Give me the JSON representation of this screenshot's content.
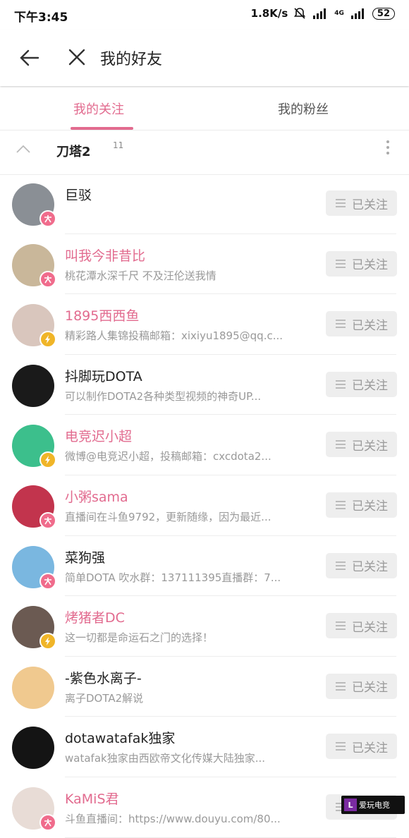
{
  "status": {
    "time": "下午3:45",
    "speed": "1.8K/s",
    "network": "4G",
    "battery": "52"
  },
  "header": {
    "title": "我的好友"
  },
  "tabs": [
    {
      "label": "我的关注"
    },
    {
      "label": "我的粉丝"
    }
  ],
  "group": {
    "name": "刀塔2",
    "count": "11"
  },
  "follow_label": "已关注",
  "users": [
    {
      "name": "巨驳",
      "desc": "",
      "name_color": "dark",
      "badge": "da",
      "avatar_color": "#8a8f95"
    },
    {
      "name": "叫我今非昔比",
      "desc": "桃花潭水深千尺 不及汪伦送我情",
      "name_color": "pink",
      "badge": "da",
      "avatar_color": "#c9b79a"
    },
    {
      "name": "1895西西鱼",
      "desc": "精彩路人集锦投稿邮箱：xixiyu1895@qq.c...",
      "name_color": "pink",
      "badge": "v",
      "avatar_color": "#d9c6bd"
    },
    {
      "name": "抖脚玩DOTA",
      "desc": "可以制作DOTA2各种类型视频的神奇UP...",
      "name_color": "dark",
      "badge": "",
      "avatar_color": "#1a1a1a"
    },
    {
      "name": "电竞迟小超",
      "desc": "微博@电竞迟小超，投稿邮箱：cxcdota2...",
      "name_color": "pink",
      "badge": "v",
      "avatar_color": "#3cbf8c"
    },
    {
      "name": "小粥sama",
      "desc": "直播间在斗鱼9792，更新随缘，因为最近...",
      "name_color": "pink",
      "badge": "da",
      "avatar_color": "#c2344d"
    },
    {
      "name": "菜狗强",
      "desc": "简单DOTA 吹水群：137111395直播群：7...",
      "name_color": "dark",
      "badge": "da",
      "avatar_color": "#7ab7e0"
    },
    {
      "name": "烤猪者DC",
      "desc": "这一切都是命运石之门的选择！",
      "name_color": "pink",
      "badge": "v",
      "avatar_color": "#6b5a52"
    },
    {
      "name": "-紫色水离子-",
      "desc": "离子DOTA2解说",
      "name_color": "dark",
      "badge": "",
      "avatar_color": "#f0c98f"
    },
    {
      "name": "dotawatafak独家",
      "desc": "watafak独家由西欧帝文化传媒大陆独家...",
      "name_color": "dark",
      "badge": "",
      "avatar_color": "#141414"
    },
    {
      "name": "KaMiS君",
      "desc": "斗鱼直播间：https://www.douyu.com/80...",
      "name_color": "pink",
      "badge": "da",
      "avatar_color": "#e8dcd6"
    }
  ],
  "watermark": {
    "text": "爱玩电竞"
  }
}
